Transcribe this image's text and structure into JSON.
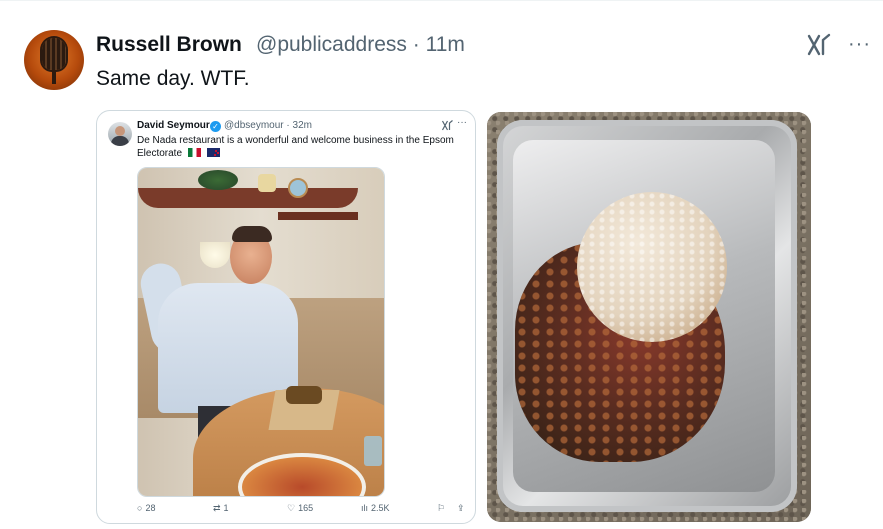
{
  "post": {
    "author_name": "Russell Brown",
    "author_handle": "@publicaddress",
    "separator": "·",
    "time": "11m",
    "text": "Same day. WTF.",
    "more_label": "···"
  },
  "embedded": {
    "author_name": "David Seymour",
    "verified_mark": "✓",
    "author_handle": "@dbseymour",
    "separator": "·",
    "time": "32m",
    "more_label": "···",
    "text": "De Nada restaurant is a wonderful and welcome business in the Epsom Electorate",
    "flags": [
      "mexico-flag",
      "new-zealand-flag"
    ],
    "actions": {
      "replies": {
        "icon": "reply-icon",
        "glyph": "○",
        "count": "28"
      },
      "reposts": {
        "icon": "repost-icon",
        "glyph": "⇄",
        "count": "1"
      },
      "likes": {
        "icon": "heart-icon",
        "glyph": "♡",
        "count": "165"
      },
      "views": {
        "icon": "views-icon",
        "glyph": "ılı",
        "count": "2.5K"
      },
      "bookmark": {
        "icon": "bookmark-icon",
        "glyph": "⚐"
      },
      "share": {
        "icon": "share-icon",
        "glyph": "⇪"
      }
    }
  },
  "colors": {
    "text_primary": "#0f1419",
    "text_secondary": "#536471",
    "verified_blue": "#1d9bf0",
    "border": "#cfd9de"
  }
}
